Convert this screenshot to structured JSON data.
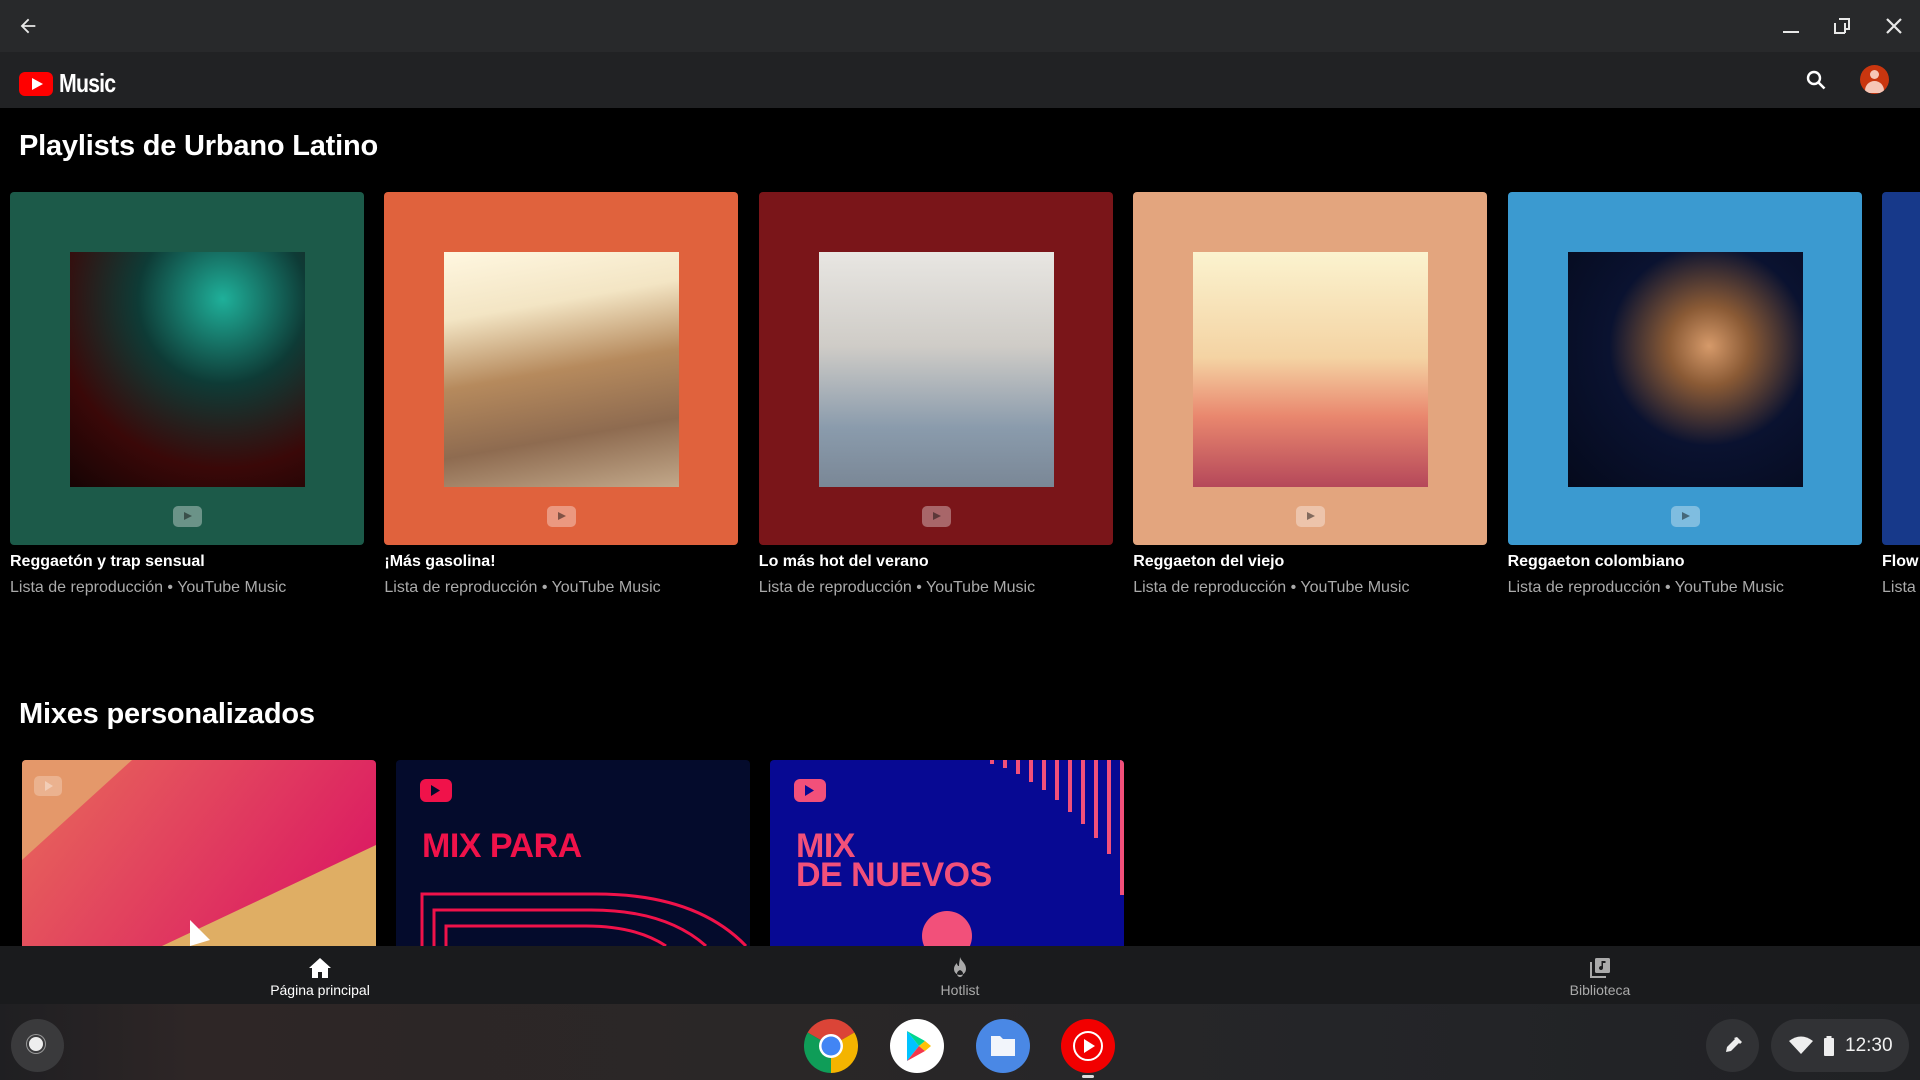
{
  "window": {
    "back_icon": "arrow-left-icon",
    "minimize_icon": "minimize-icon",
    "restore_icon": "restore-icon",
    "close_icon": "close-icon"
  },
  "appbar": {
    "logo_text": "Music",
    "search_icon": "search-icon",
    "avatar_icon": "account-avatar-icon"
  },
  "sections": [
    {
      "title": "Playlists de Urbano Latino",
      "items": [
        {
          "title": "Reggaetón y trap sensual",
          "subtitle": "Lista de reproducción • YouTube Music",
          "bg": "#1c5a49"
        },
        {
          "title": "¡Más gasolina!",
          "subtitle": "Lista de reproducción • YouTube Music",
          "bg": "#e0623d"
        },
        {
          "title": "Lo más hot del verano",
          "subtitle": "Lista de reproducción • YouTube Music",
          "bg": "#7a1519"
        },
        {
          "title": "Reggaeton del viejo",
          "subtitle": "Lista de reproducción • YouTube Music",
          "bg": "#e3a57e"
        },
        {
          "title": "Reggaeton  colombiano",
          "subtitle": "Lista de reproducción • YouTube Music",
          "bg": "#3b9ad0"
        },
        {
          "title": "Flow",
          "subtitle": "Lista",
          "bg": "#17398a"
        }
      ]
    },
    {
      "title": "Mixes personalizados",
      "items": [
        {
          "label": "",
          "bg": "#d9285f"
        },
        {
          "label": "MIX PARA",
          "bg": "#040b2c"
        },
        {
          "label_line1": "MIX",
          "label_line2": "DE NUEVOS",
          "bg": "#070993"
        }
      ]
    }
  ],
  "bottom_nav": [
    {
      "label": "Página principal",
      "icon": "home-icon",
      "active": true
    },
    {
      "label": "Hotlist",
      "icon": "fire-icon",
      "active": false
    },
    {
      "label": "Biblioteca",
      "icon": "library-music-icon",
      "active": false
    }
  ],
  "shelf": {
    "apps": [
      {
        "name": "Chrome",
        "icon": "chrome-icon"
      },
      {
        "name": "Play Store",
        "icon": "play-store-icon"
      },
      {
        "name": "Files",
        "icon": "files-icon"
      },
      {
        "name": "YouTube Music",
        "icon": "youtube-music-icon",
        "active": true
      }
    ],
    "stylus_icon": "stylus-icon",
    "wifi_icon": "wifi-icon",
    "battery_icon": "battery-icon",
    "time": "12:30"
  },
  "colors": {
    "accent": "#ff0000",
    "titlebar": "#28292b",
    "appbar": "#212224",
    "bottom_nav": "#1a1b1d",
    "inactive_text": "#aaaaaa"
  }
}
